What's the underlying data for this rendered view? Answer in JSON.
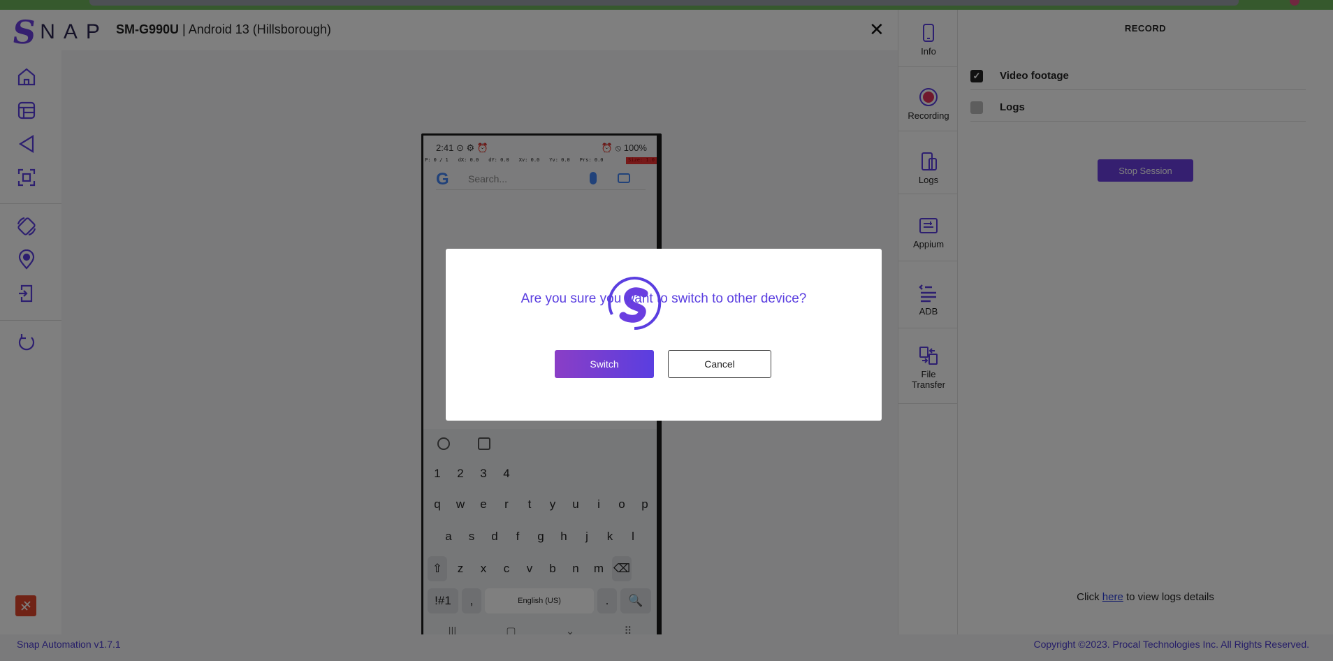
{
  "app": {
    "logo_letter": "S",
    "logo_text": "NAP",
    "device_model": "SM-G990U",
    "device_os": "Android 13 (Hillsborough)",
    "close_label": "✕",
    "brand_color": "#6a3ee0"
  },
  "sidebar": {
    "items": [
      {
        "name": "home-icon"
      },
      {
        "name": "app-grid-icon"
      },
      {
        "name": "back-icon"
      },
      {
        "name": "screenshot-icon"
      },
      {
        "name": "rotate-icon"
      },
      {
        "name": "location-icon"
      },
      {
        "name": "install-icon"
      },
      {
        "name": "refresh-icon"
      }
    ],
    "bug_icon": "bug-icon"
  },
  "phone": {
    "time": "2:41",
    "status_left_icons": "⊙ ⚙ ⏰",
    "status_right": "⏰ ⦸ 100%",
    "debug": [
      "P: 0 / 1",
      "dX: 0.0",
      "dY: 0.0",
      "Xv: 0.0",
      "Yv: 0.0",
      "Prs: 0.0",
      "Size: 1.0"
    ],
    "search_placeholder": "Search...",
    "google_letter": "G",
    "keyboard": {
      "numbers": [
        "1",
        "2",
        "3",
        "4"
      ],
      "row1": [
        "q",
        "w",
        "e",
        "r",
        "t",
        "y",
        "u",
        "i",
        "o",
        "p"
      ],
      "row2": [
        "a",
        "s",
        "d",
        "f",
        "g",
        "h",
        "j",
        "k",
        "l"
      ],
      "row3": [
        "⇧",
        "z",
        "x",
        "c",
        "v",
        "b",
        "n",
        "m",
        "⌫"
      ],
      "sym": "!#1",
      "comma": ",",
      "space": "English (US)",
      "period": ".",
      "search_key": "🔍"
    },
    "nav": [
      "|||",
      "▢",
      "⌄",
      "⠿"
    ]
  },
  "rail": {
    "items": [
      {
        "label": "Info",
        "icon": "phone-icon"
      },
      {
        "label": "Recording",
        "icon": "record-icon"
      },
      {
        "label": "Logs",
        "icon": "logs-icon"
      },
      {
        "label": "Appium",
        "icon": "appium-icon"
      },
      {
        "label": "ADB",
        "icon": "adb-icon"
      },
      {
        "label": "File Transfer",
        "icon": "file-transfer-icon"
      }
    ]
  },
  "panel": {
    "title": "RECORD",
    "options": [
      {
        "label": "Video footage",
        "checked": true
      },
      {
        "label": "Logs",
        "checked": false
      }
    ],
    "stop_button": "Stop Session",
    "logs_prefix": "Click ",
    "logs_link": "here",
    "logs_suffix": " to view logs details"
  },
  "footer": {
    "version": "Snap Automation v1.7.1",
    "copyright": "Copyright ©2023. Procal Technologies Inc. All Rights Reserved."
  },
  "modal": {
    "message": "Are you sure you want to switch to other device?",
    "confirm": "Switch",
    "cancel": "Cancel"
  }
}
